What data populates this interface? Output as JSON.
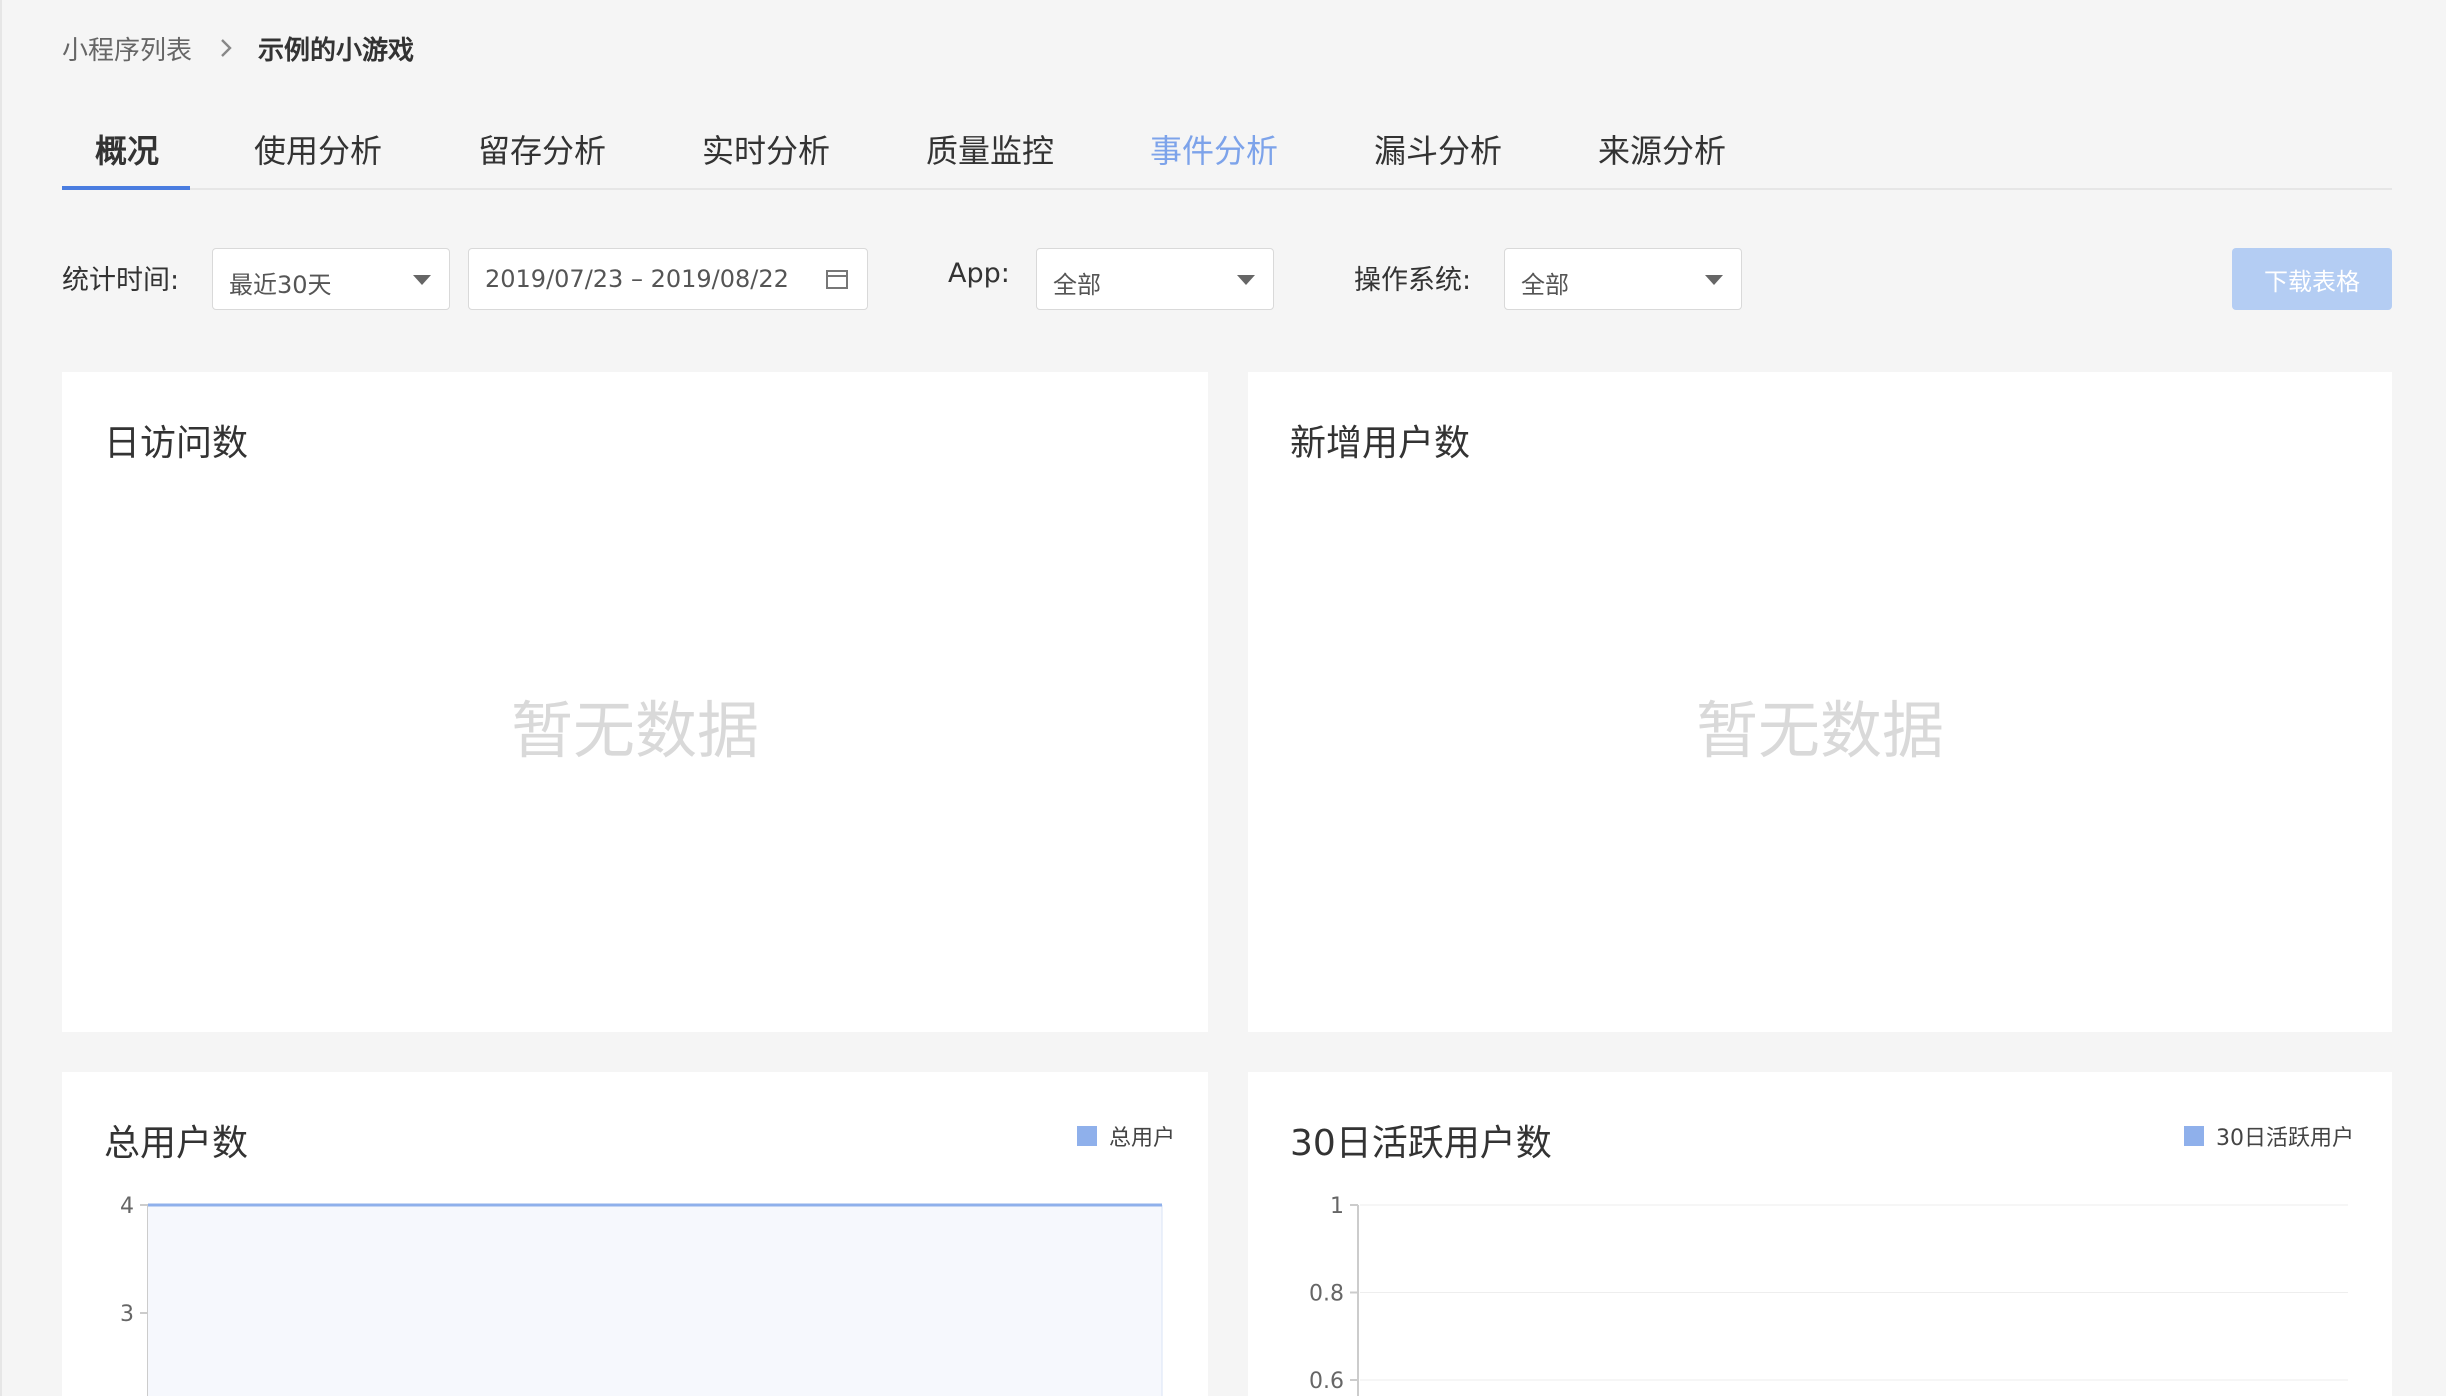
{
  "breadcrumb": {
    "parent": "小程序列表",
    "current": "示例的小游戏"
  },
  "tabs": [
    {
      "label": "概况",
      "active": true
    },
    {
      "label": "使用分析"
    },
    {
      "label": "留存分析"
    },
    {
      "label": "实时分析"
    },
    {
      "label": "质量监控"
    },
    {
      "label": "事件分析",
      "highlighted": true
    },
    {
      "label": "漏斗分析"
    },
    {
      "label": "来源分析"
    }
  ],
  "filters": {
    "time_label": "统计时间:",
    "time_value": "最近30天",
    "date_range": "2019/07/23 – 2019/08/22",
    "app_label": "App:",
    "app_value": "全部",
    "os_label": "操作系统:",
    "os_value": "全部",
    "download_label": "下载表格"
  },
  "cards": {
    "daily_visits": {
      "title": "日访问数",
      "empty": "暂无数据"
    },
    "new_users": {
      "title": "新增用户数",
      "empty": "暂无数据"
    },
    "total_users": {
      "title": "总用户数",
      "legend": "总用户"
    },
    "active_30d": {
      "title": "30日活跃用户数",
      "legend": "30日活跃用户"
    }
  },
  "colors": {
    "accent": "#4a7de0",
    "series": "#8fb0eb",
    "highlight_tab": "#7da3ea",
    "button_disabled": "#b4cdf3"
  },
  "chart_data": [
    {
      "type": "area",
      "series": [
        {
          "name": "总用户",
          "values": [
            4,
            4
          ]
        }
      ],
      "y_ticks": [
        "4",
        "3"
      ],
      "ylim_visible": [
        3,
        4
      ]
    },
    {
      "type": "line",
      "series": [
        {
          "name": "30日活跃用户",
          "values": []
        }
      ],
      "y_ticks": [
        "1",
        "0.8",
        "0.6"
      ],
      "ylim_visible": [
        0.6,
        1
      ]
    }
  ]
}
